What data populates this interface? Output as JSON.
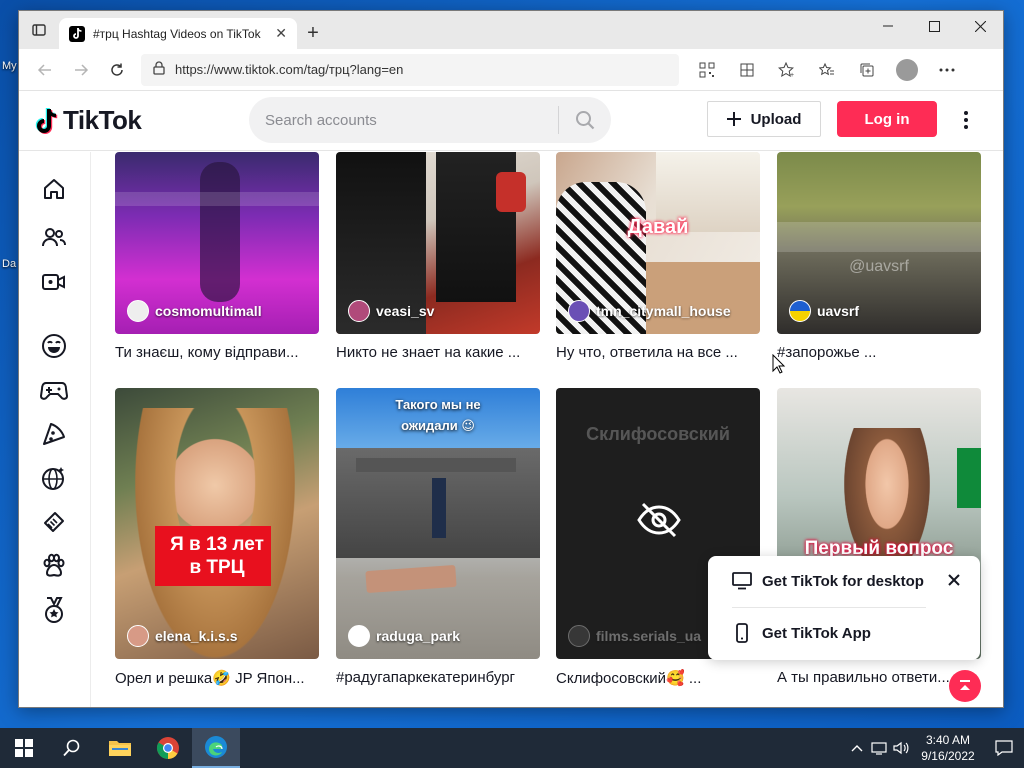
{
  "desktop": {
    "labels": [
      "My",
      "Da"
    ]
  },
  "browser": {
    "tab_title": "#трц Hashtag Videos on TikTok",
    "url": "https://www.tiktok.com/tag/трц?lang=en"
  },
  "header": {
    "logo": "TikTok",
    "search_placeholder": "Search accounts",
    "upload_label": "Upload",
    "login_label": "Log in"
  },
  "videos": [
    {
      "author": "cosmomultimall",
      "caption": "Ти знаєш, кому відправи..."
    },
    {
      "author": "veasi_sv",
      "caption": "Никто не знает на какие ..."
    },
    {
      "author": "tmn_citymall_house",
      "caption": "Ну что, ответила на все ...",
      "overlay": "Давай"
    },
    {
      "author": "uavsrf",
      "caption": "#запорожье ...",
      "watermark": "@uavsrf"
    },
    {
      "author": "elena_k.i.s.s",
      "caption": "Орел и решка🤣 JP Япон...",
      "overlay": "Я в 13 лет\nв ТРЦ"
    },
    {
      "author": "raduga_park",
      "caption": "#радугапаркекатеринбург",
      "overlay": "Такого мы не\nожидали 😉"
    },
    {
      "author": "films.serials_ua",
      "caption": "Склифосовский🥰 ...",
      "overlay": "Склифосовский"
    },
    {
      "author": "",
      "caption": "А ты правильно ответи...",
      "overlay": "Первый вопрос"
    }
  ],
  "popup": {
    "desktop_label": "Get TikTok for desktop",
    "app_label": "Get TikTok App"
  },
  "taskbar": {
    "time": "3:40 AM",
    "date": "9/16/2022"
  }
}
